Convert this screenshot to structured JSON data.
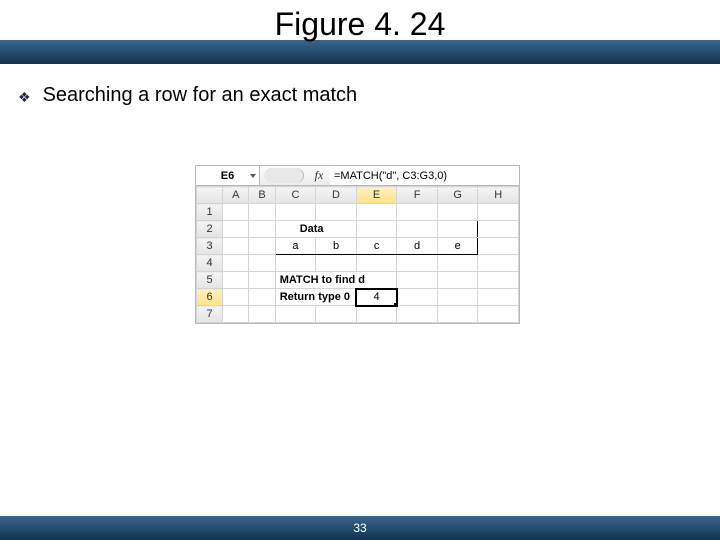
{
  "slide": {
    "title": "Figure 4. 24",
    "bullet": "Searching a row for an exact match",
    "page_number": "33"
  },
  "excel": {
    "name_box": "E6",
    "fx_label": "fx",
    "formula": "=MATCH(\"d\", C3:G3,0)",
    "columns": [
      "A",
      "B",
      "C",
      "D",
      "E",
      "F",
      "G",
      "H"
    ],
    "rows": [
      "1",
      "2",
      "3",
      "4",
      "5",
      "6",
      "7"
    ],
    "labels": {
      "data_header": "Data",
      "match_find": "MATCH to find d",
      "return_type": "Return type 0"
    },
    "data_row": [
      "a",
      "b",
      "c",
      "d",
      "e"
    ],
    "result_value": "4",
    "selected_cell": "E6"
  }
}
